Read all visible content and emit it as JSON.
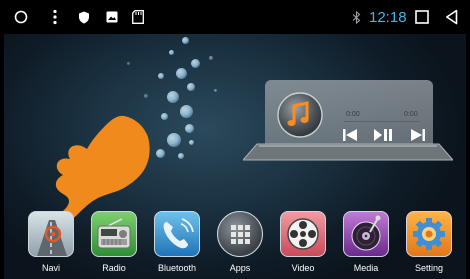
{
  "status_bar": {
    "time": "12:18",
    "accent": "#3fb7e6"
  },
  "music_widget": {
    "elapsed": "0:00",
    "duration": "0:00",
    "controls": [
      "previous-icon",
      "play-pause-icon",
      "next-icon"
    ]
  },
  "dock": {
    "items": [
      {
        "label": "Navi",
        "icon": "navigation-icon"
      },
      {
        "label": "Radio",
        "icon": "radio-icon"
      },
      {
        "label": "Bluetooth",
        "icon": "bluetooth-phone-icon"
      },
      {
        "label": "Apps",
        "icon": "apps-grid-icon"
      },
      {
        "label": "Video",
        "icon": "film-reel-icon"
      },
      {
        "label": "Media",
        "icon": "media-disc-icon"
      },
      {
        "label": "Setting",
        "icon": "gear-icon"
      }
    ]
  },
  "overlay": {
    "icon": "pointing-hand-icon",
    "color": "#f08a1d"
  }
}
